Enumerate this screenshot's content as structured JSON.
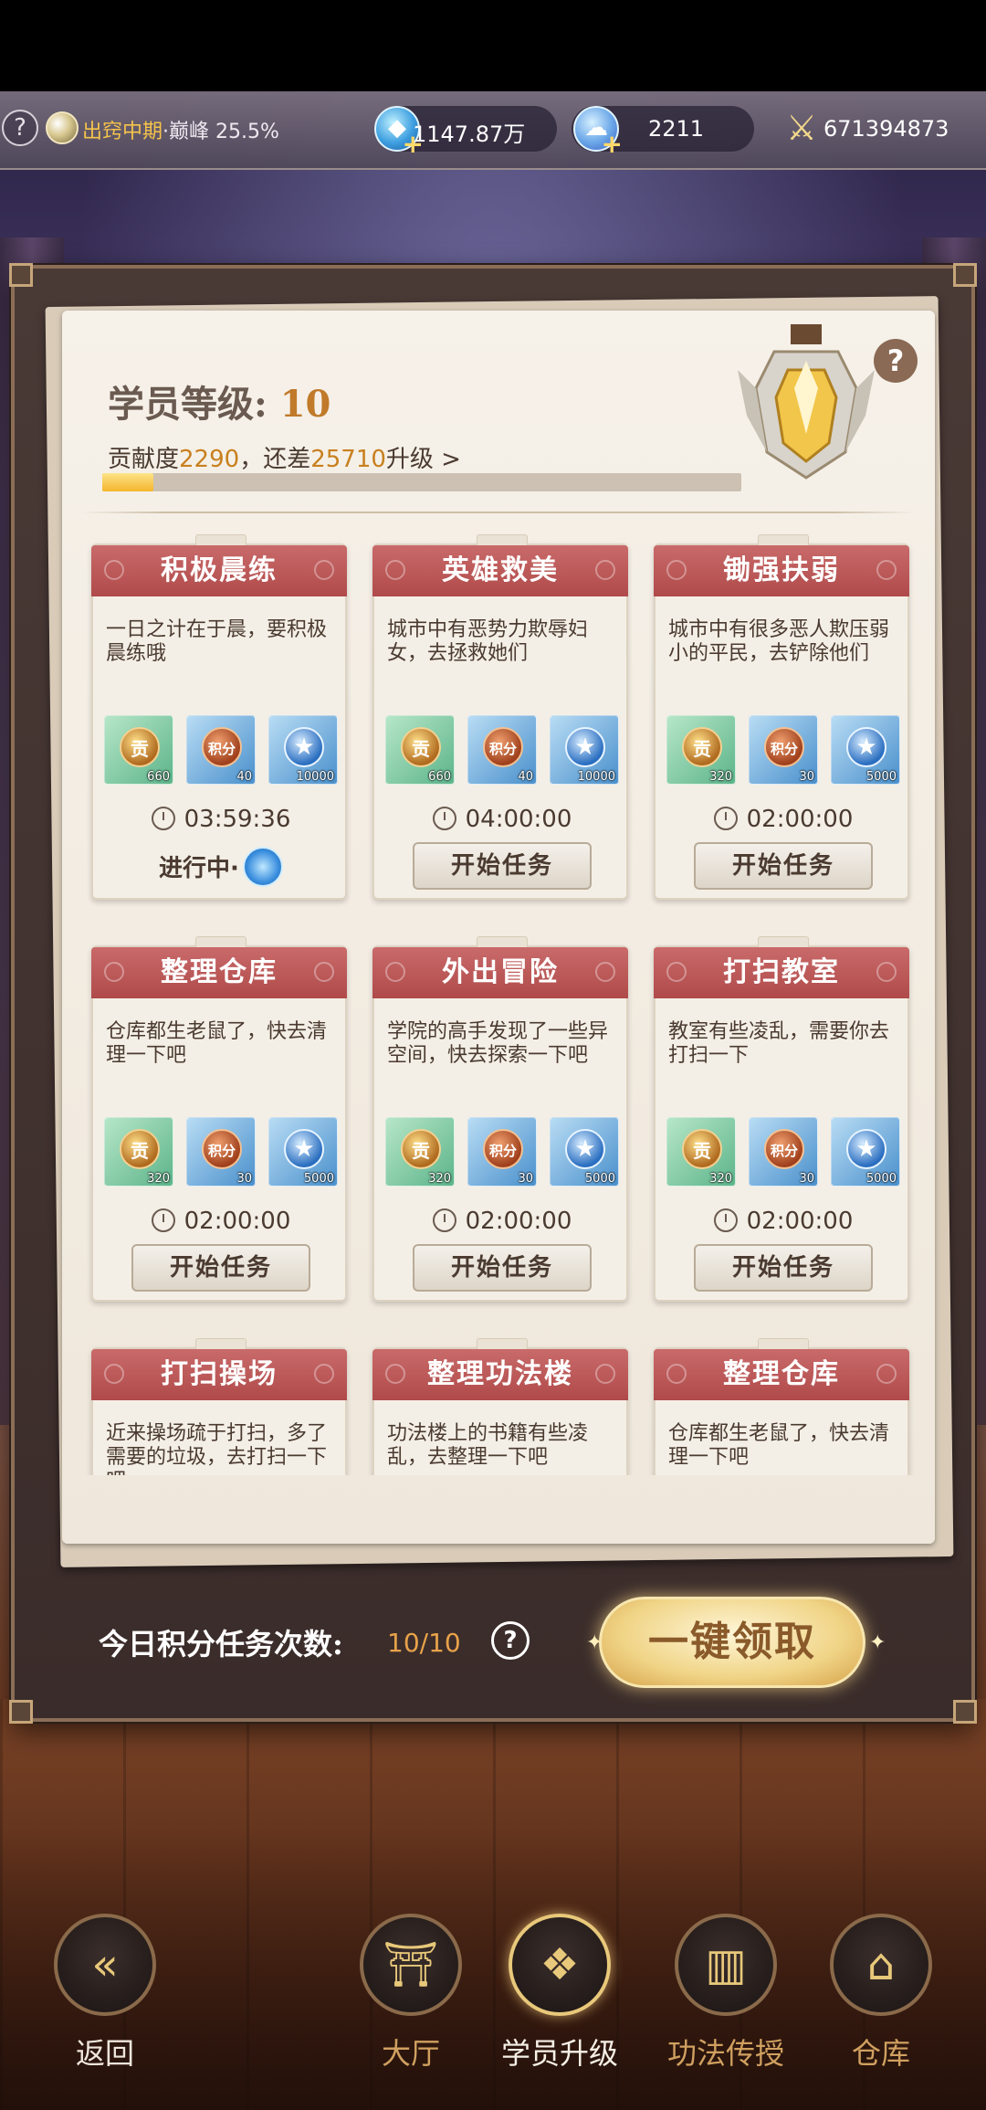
{
  "topbar": {
    "help": "?",
    "realm_name": "出窍中期",
    "realm_sep": "·",
    "realm_stage": "巅峰",
    "realm_percent": "25.5%",
    "currency1_value": "1147.87万",
    "currency2_value": "2211",
    "power_value": "671394873",
    "plus": "+"
  },
  "header": {
    "level_label": "学员等级:",
    "level_value": "10",
    "contrib_prefix": "贡献度",
    "contrib_value": "2290",
    "contrib_mid": "，还差",
    "contrib_remaining": "25710",
    "contrib_suffix": "升级 >",
    "progress": 0.08,
    "help": "?"
  },
  "tasks": [
    {
      "title": "积极晨练",
      "desc": "一日之计在于晨，要积极晨练哦",
      "rewards": [
        "660",
        "40",
        "10000"
      ],
      "time": "03:59:36",
      "status": "进行中·",
      "in_progress": true
    },
    {
      "title": "英雄救美",
      "desc": "城市中有恶势力欺辱妇女，去拯救她们",
      "rewards": [
        "660",
        "40",
        "10000"
      ],
      "time": "04:00:00",
      "status": "开始任务",
      "in_progress": false
    },
    {
      "title": "锄强扶弱",
      "desc": "城市中有很多恶人欺压弱小的平民，去铲除他们",
      "rewards": [
        "320",
        "30",
        "5000"
      ],
      "time": "02:00:00",
      "status": "开始任务",
      "in_progress": false
    },
    {
      "title": "整理仓库",
      "desc": "仓库都生老鼠了，快去清理一下吧",
      "rewards": [
        "320",
        "30",
        "5000"
      ],
      "time": "02:00:00",
      "status": "开始任务",
      "in_progress": false
    },
    {
      "title": "外出冒险",
      "desc": "学院的高手发现了一些异空间，快去探索一下吧",
      "rewards": [
        "320",
        "30",
        "5000"
      ],
      "time": "02:00:00",
      "status": "开始任务",
      "in_progress": false
    },
    {
      "title": "打扫教室",
      "desc": "教室有些凌乱，需要你去打扫一下",
      "rewards": [
        "320",
        "30",
        "5000"
      ],
      "time": "02:00:00",
      "status": "开始任务",
      "in_progress": false
    },
    {
      "title": "打扫操场",
      "desc": "近来操场疏于打扫，多了需要的垃圾，去打扫一下吧",
      "rewards": [
        "",
        "",
        ""
      ],
      "time": "",
      "status": "",
      "in_progress": false
    },
    {
      "title": "整理功法楼",
      "desc": "功法楼上的书籍有些凌乱，去整理一下吧",
      "rewards": [
        "",
        "",
        ""
      ],
      "time": "",
      "status": "",
      "in_progress": false
    },
    {
      "title": "整理仓库",
      "desc": "仓库都生老鼠了，快去清理一下吧",
      "rewards": [
        "",
        "",
        ""
      ],
      "time": "",
      "status": "",
      "in_progress": false
    }
  ],
  "reward_icons": {
    "gong": "贡",
    "jifen": "积分",
    "star": "★"
  },
  "footer": {
    "daily_label": "今日积分任务次数:",
    "daily_count": "10/10",
    "help": "?",
    "claim_all": "一键领取"
  },
  "nav": {
    "back": "返回",
    "hall": "大厅",
    "upgrade": "学员升级",
    "skills": "功法传授",
    "storage": "仓库"
  },
  "colors": {
    "accent_red": "#b04a4a",
    "gold": "#f4b52c",
    "bg_dark": "#3a2c2a"
  }
}
